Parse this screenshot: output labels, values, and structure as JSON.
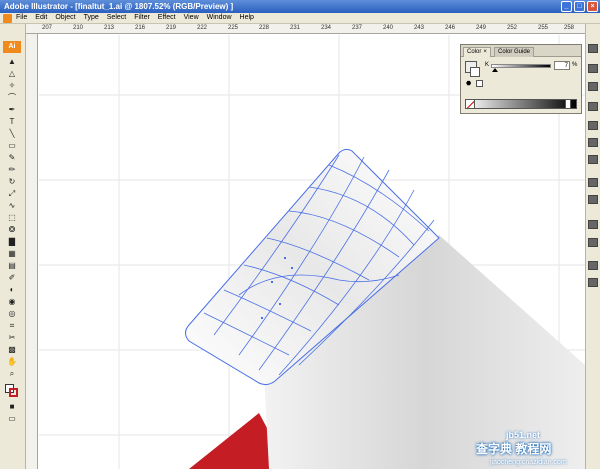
{
  "window": {
    "title": "Adobe Illustrator - [finaltut_1.ai @ 1807.52% (RGB/Preview) ]",
    "minimize_label": "_",
    "maximize_label": "□",
    "close_label": "×"
  },
  "menu": {
    "items": [
      "File",
      "Edit",
      "Object",
      "Type",
      "Select",
      "Filter",
      "Effect",
      "View",
      "Window",
      "Help"
    ]
  },
  "ruler": {
    "top_ticks": [
      "207",
      "210",
      "213",
      "216",
      "219",
      "222",
      "225",
      "228",
      "231",
      "234",
      "237",
      "240",
      "243",
      "246",
      "249",
      "252",
      "255",
      "258"
    ]
  },
  "tools": {
    "logo": "Ai"
  },
  "color_panel": {
    "tab_color": "Color",
    "tab_color_guide": "Color Guide",
    "channel_label": "K",
    "channel_value": "7",
    "percent_sign": "%",
    "close_glyph": "×",
    "k_fraction": 0.07
  },
  "watermark": {
    "site": "jb51.net",
    "chinese_text": "查字典 教程网",
    "url": "jiaocheng.chazidian.com"
  },
  "colors": {
    "mesh_line": "#4a6fe6",
    "red_accent": "#c41e24",
    "accent_orange": "#f08a1c"
  }
}
